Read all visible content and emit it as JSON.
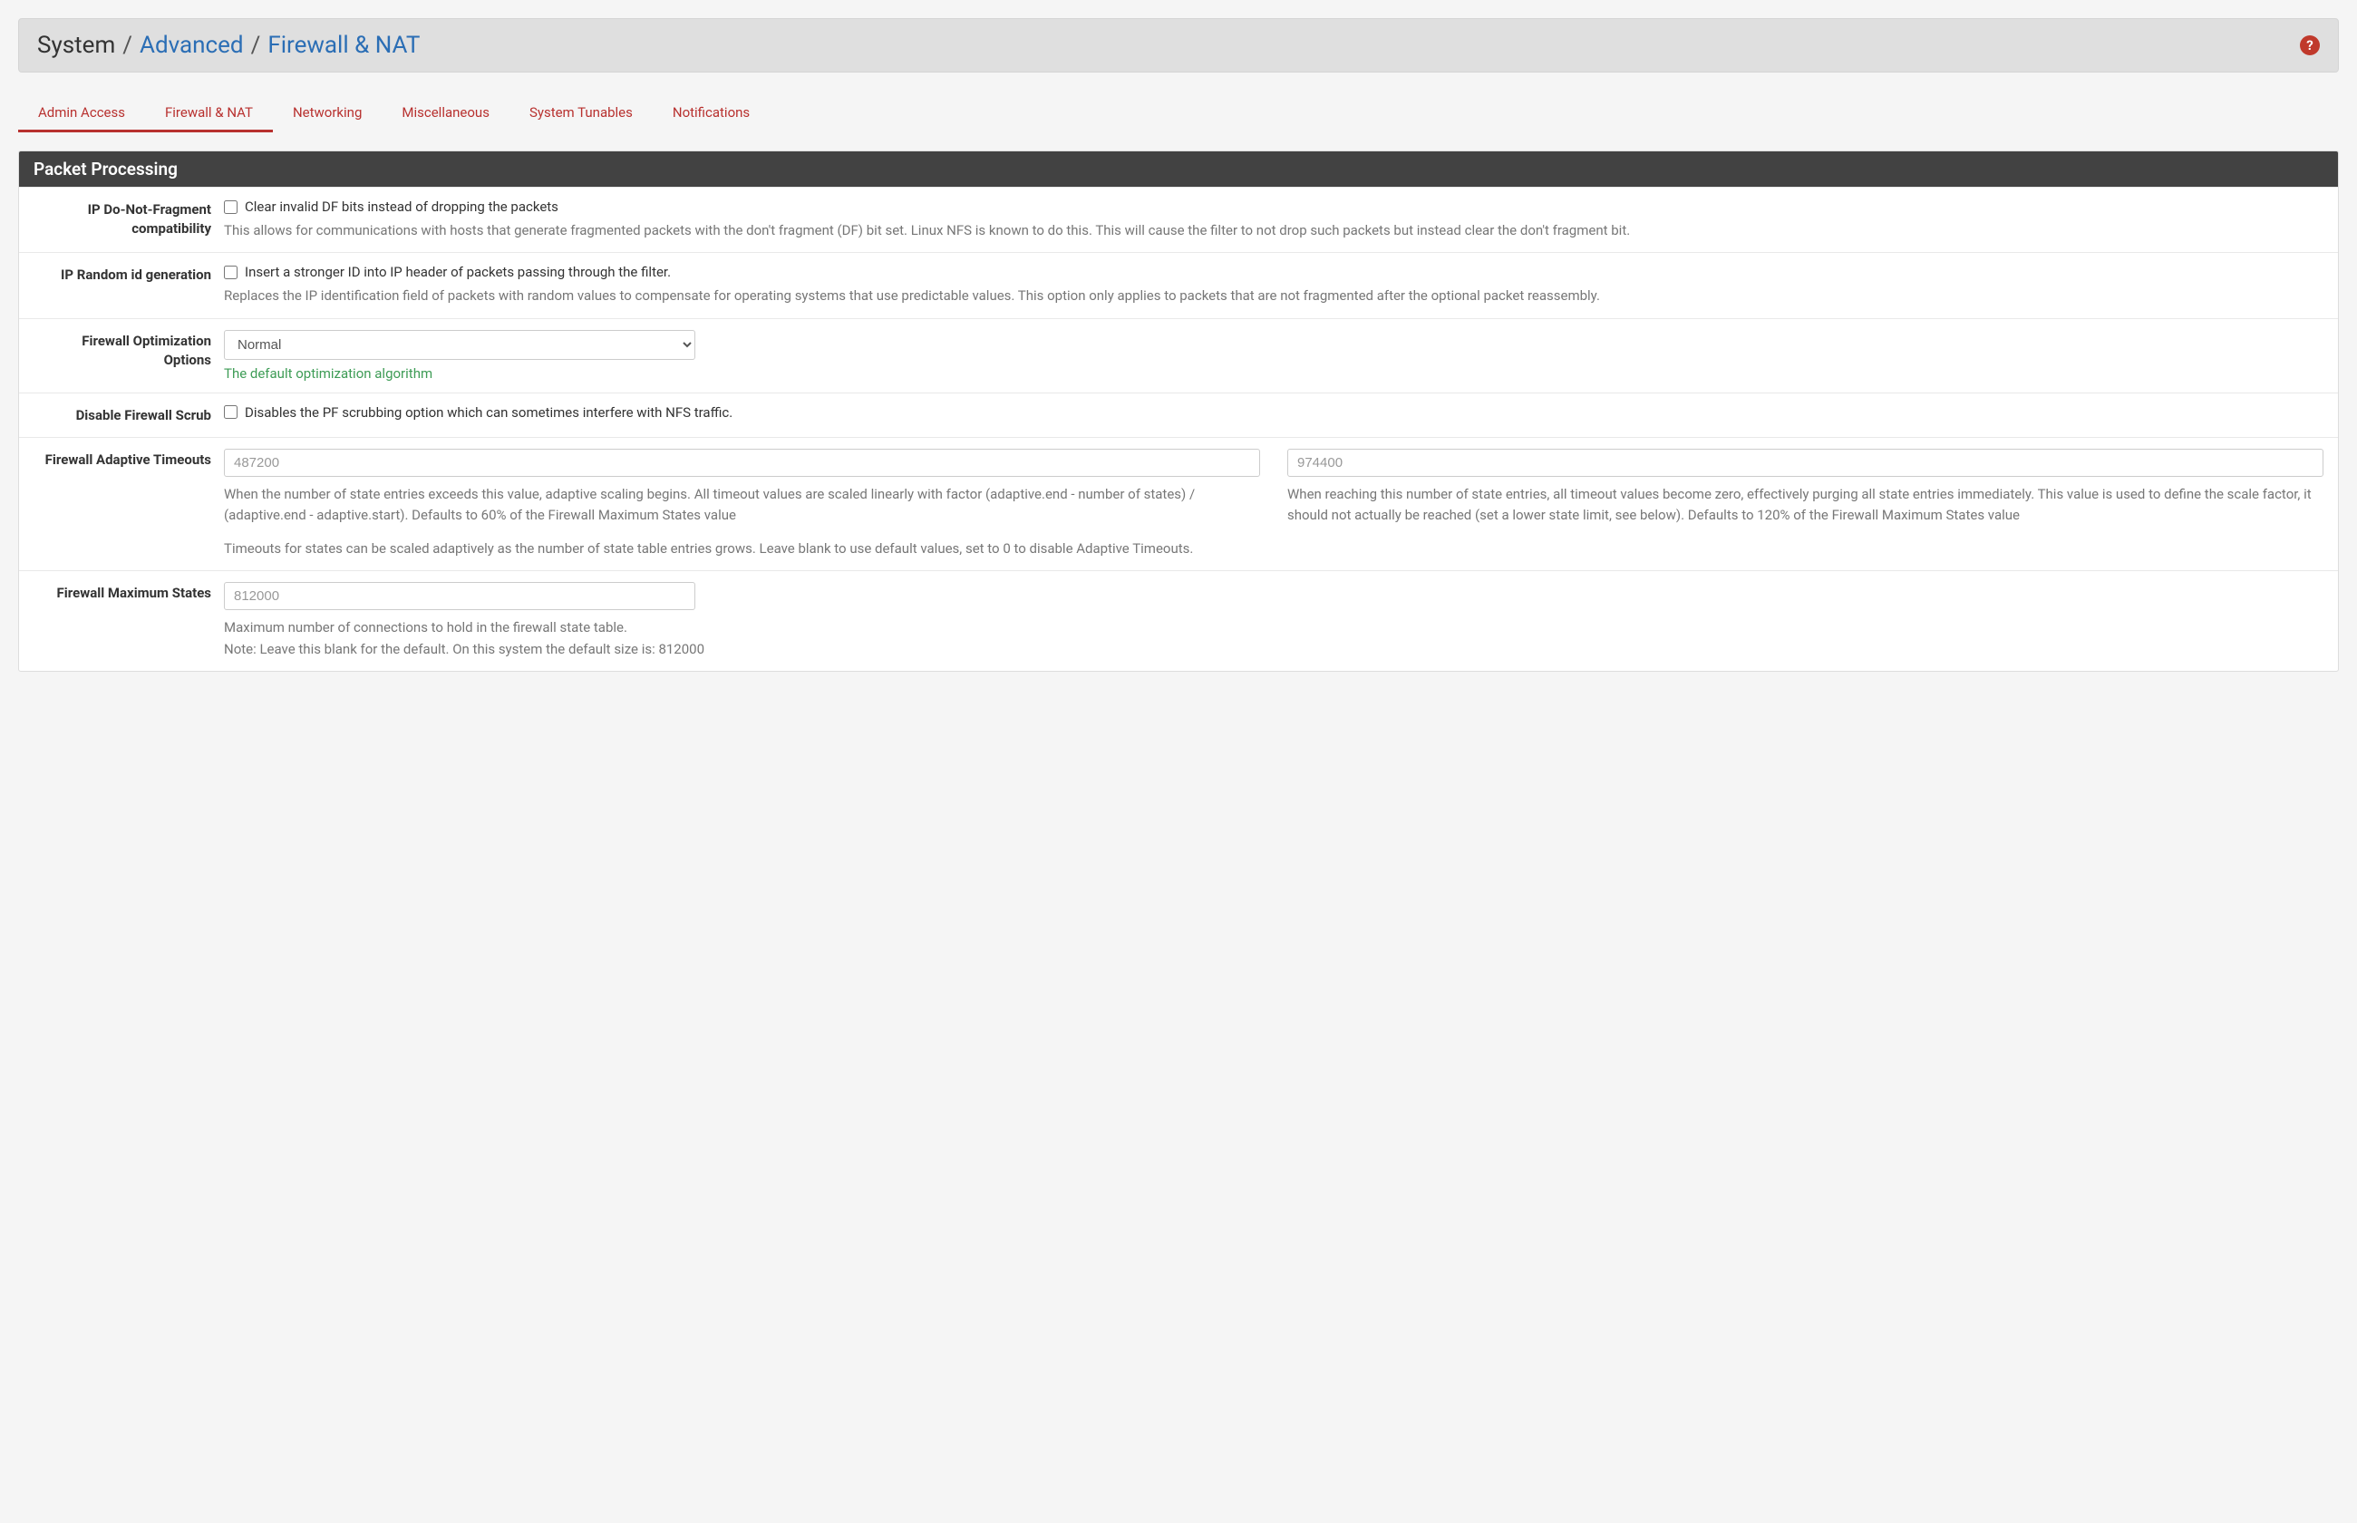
{
  "breadcrumb": {
    "root": "System",
    "level1": "Advanced",
    "level2": "Firewall & NAT"
  },
  "tabs": [
    {
      "label": "Admin Access",
      "active": true
    },
    {
      "label": "Firewall & NAT",
      "active": true
    },
    {
      "label": "Networking",
      "active": false
    },
    {
      "label": "Miscellaneous",
      "active": false
    },
    {
      "label": "System Tunables",
      "active": false
    },
    {
      "label": "Notifications",
      "active": false
    }
  ],
  "panel": {
    "title": "Packet Processing",
    "rows": {
      "dnf": {
        "label": "IP Do-Not-Fragment compatibility",
        "checkbox_label": "Clear invalid DF bits instead of dropping the packets",
        "help": "This allows for communications with hosts that generate fragmented packets with the don't fragment (DF) bit set. Linux NFS is known to do this. This will cause the filter to not drop such packets but instead clear the don't fragment bit."
      },
      "randomid": {
        "label": "IP Random id generation",
        "checkbox_label": "Insert a stronger ID into IP header of packets passing through the filter.",
        "help": "Replaces the IP identification field of packets with random values to compensate for operating systems that use predictable values. This option only applies to packets that are not fragmented after the optional packet reassembly."
      },
      "optimization": {
        "label": "Firewall Optimization Options",
        "selected": "Normal",
        "help_green": "The default optimization algorithm"
      },
      "scrub": {
        "label": "Disable Firewall Scrub",
        "checkbox_label": "Disables the PF scrubbing option which can sometimes interfere with NFS traffic."
      },
      "adaptive": {
        "label": "Firewall Adaptive Timeouts",
        "start_placeholder": "487200",
        "start_help": "When the number of state entries exceeds this value, adaptive scaling begins. All timeout values are scaled linearly with factor (adaptive.end - number of states) / (adaptive.end - adaptive.start). Defaults to 60% of the Firewall Maximum States value",
        "end_placeholder": "974400",
        "end_help": "When reaching this number of state entries, all timeout values become zero, effectively purging all state entries immediately. This value is used to define the scale factor, it should not actually be reached (set a lower state limit, see below). Defaults to 120% of the Firewall Maximum States value",
        "general_help": "Timeouts for states can be scaled adaptively as the number of state table entries grows. Leave blank to use default values, set to 0 to disable Adaptive Timeouts."
      },
      "maxstates": {
        "label": "Firewall Maximum States",
        "placeholder": "812000",
        "help_line1": "Maximum number of connections to hold in the firewall state table.",
        "help_line2": "Note: Leave this blank for the default. On this system the default size is: 812000"
      }
    }
  }
}
